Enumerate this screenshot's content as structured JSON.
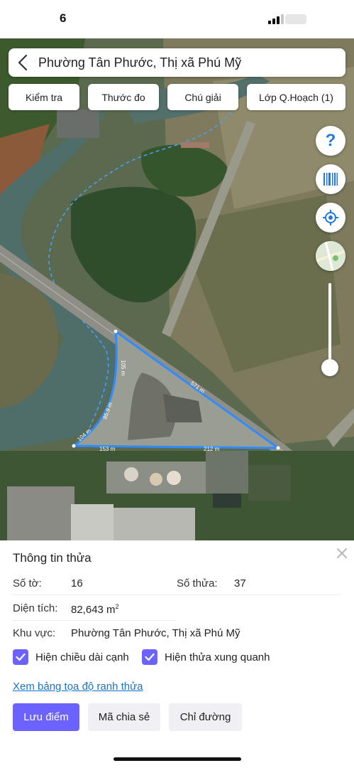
{
  "status_bar": {
    "time": "6"
  },
  "search": {
    "title": "Phường Tân Phước, Thị xã Phú Mỹ"
  },
  "tools": [
    "Kiểm tra",
    "Thước đo",
    "Chú giải",
    "Lớp Q.Hoạch (1)"
  ],
  "map": {
    "edge_labels": [
      "105 m",
      "571 m",
      "85.9 m",
      "104 m",
      "153 m",
      "212 m"
    ],
    "parcel_color": "#2f8cff"
  },
  "fab_icons": [
    "help-icon",
    "barcode-icon",
    "locate-icon",
    "map-layer-icon"
  ],
  "panel": {
    "title": "Thông tin thửa",
    "so_to_label": "Số tờ:",
    "so_to_value": "16",
    "so_thua_label": "Số thửa:",
    "so_thua_value": "37",
    "dien_tich_label": "Diện tích:",
    "dien_tich_value": "82,643 m",
    "dien_tich_unit_sup": "2",
    "khu_vuc_label": "Khu vực:",
    "khu_vuc_value": "Phường Tân Phước, Thị xã Phú Mỹ",
    "check_edge_length": "Hiện chiều dài cạnh",
    "check_edge_length_checked": true,
    "check_neighbors": "Hiện thửa xung quanh",
    "check_neighbors_checked": true,
    "coord_link": "Xem bảng tọa độ ranh thửa",
    "btn_save": "Lưu điểm",
    "btn_share": "Mã chia sẻ",
    "btn_directions": "Chỉ đường",
    "accent_color": "#6c63ff"
  }
}
